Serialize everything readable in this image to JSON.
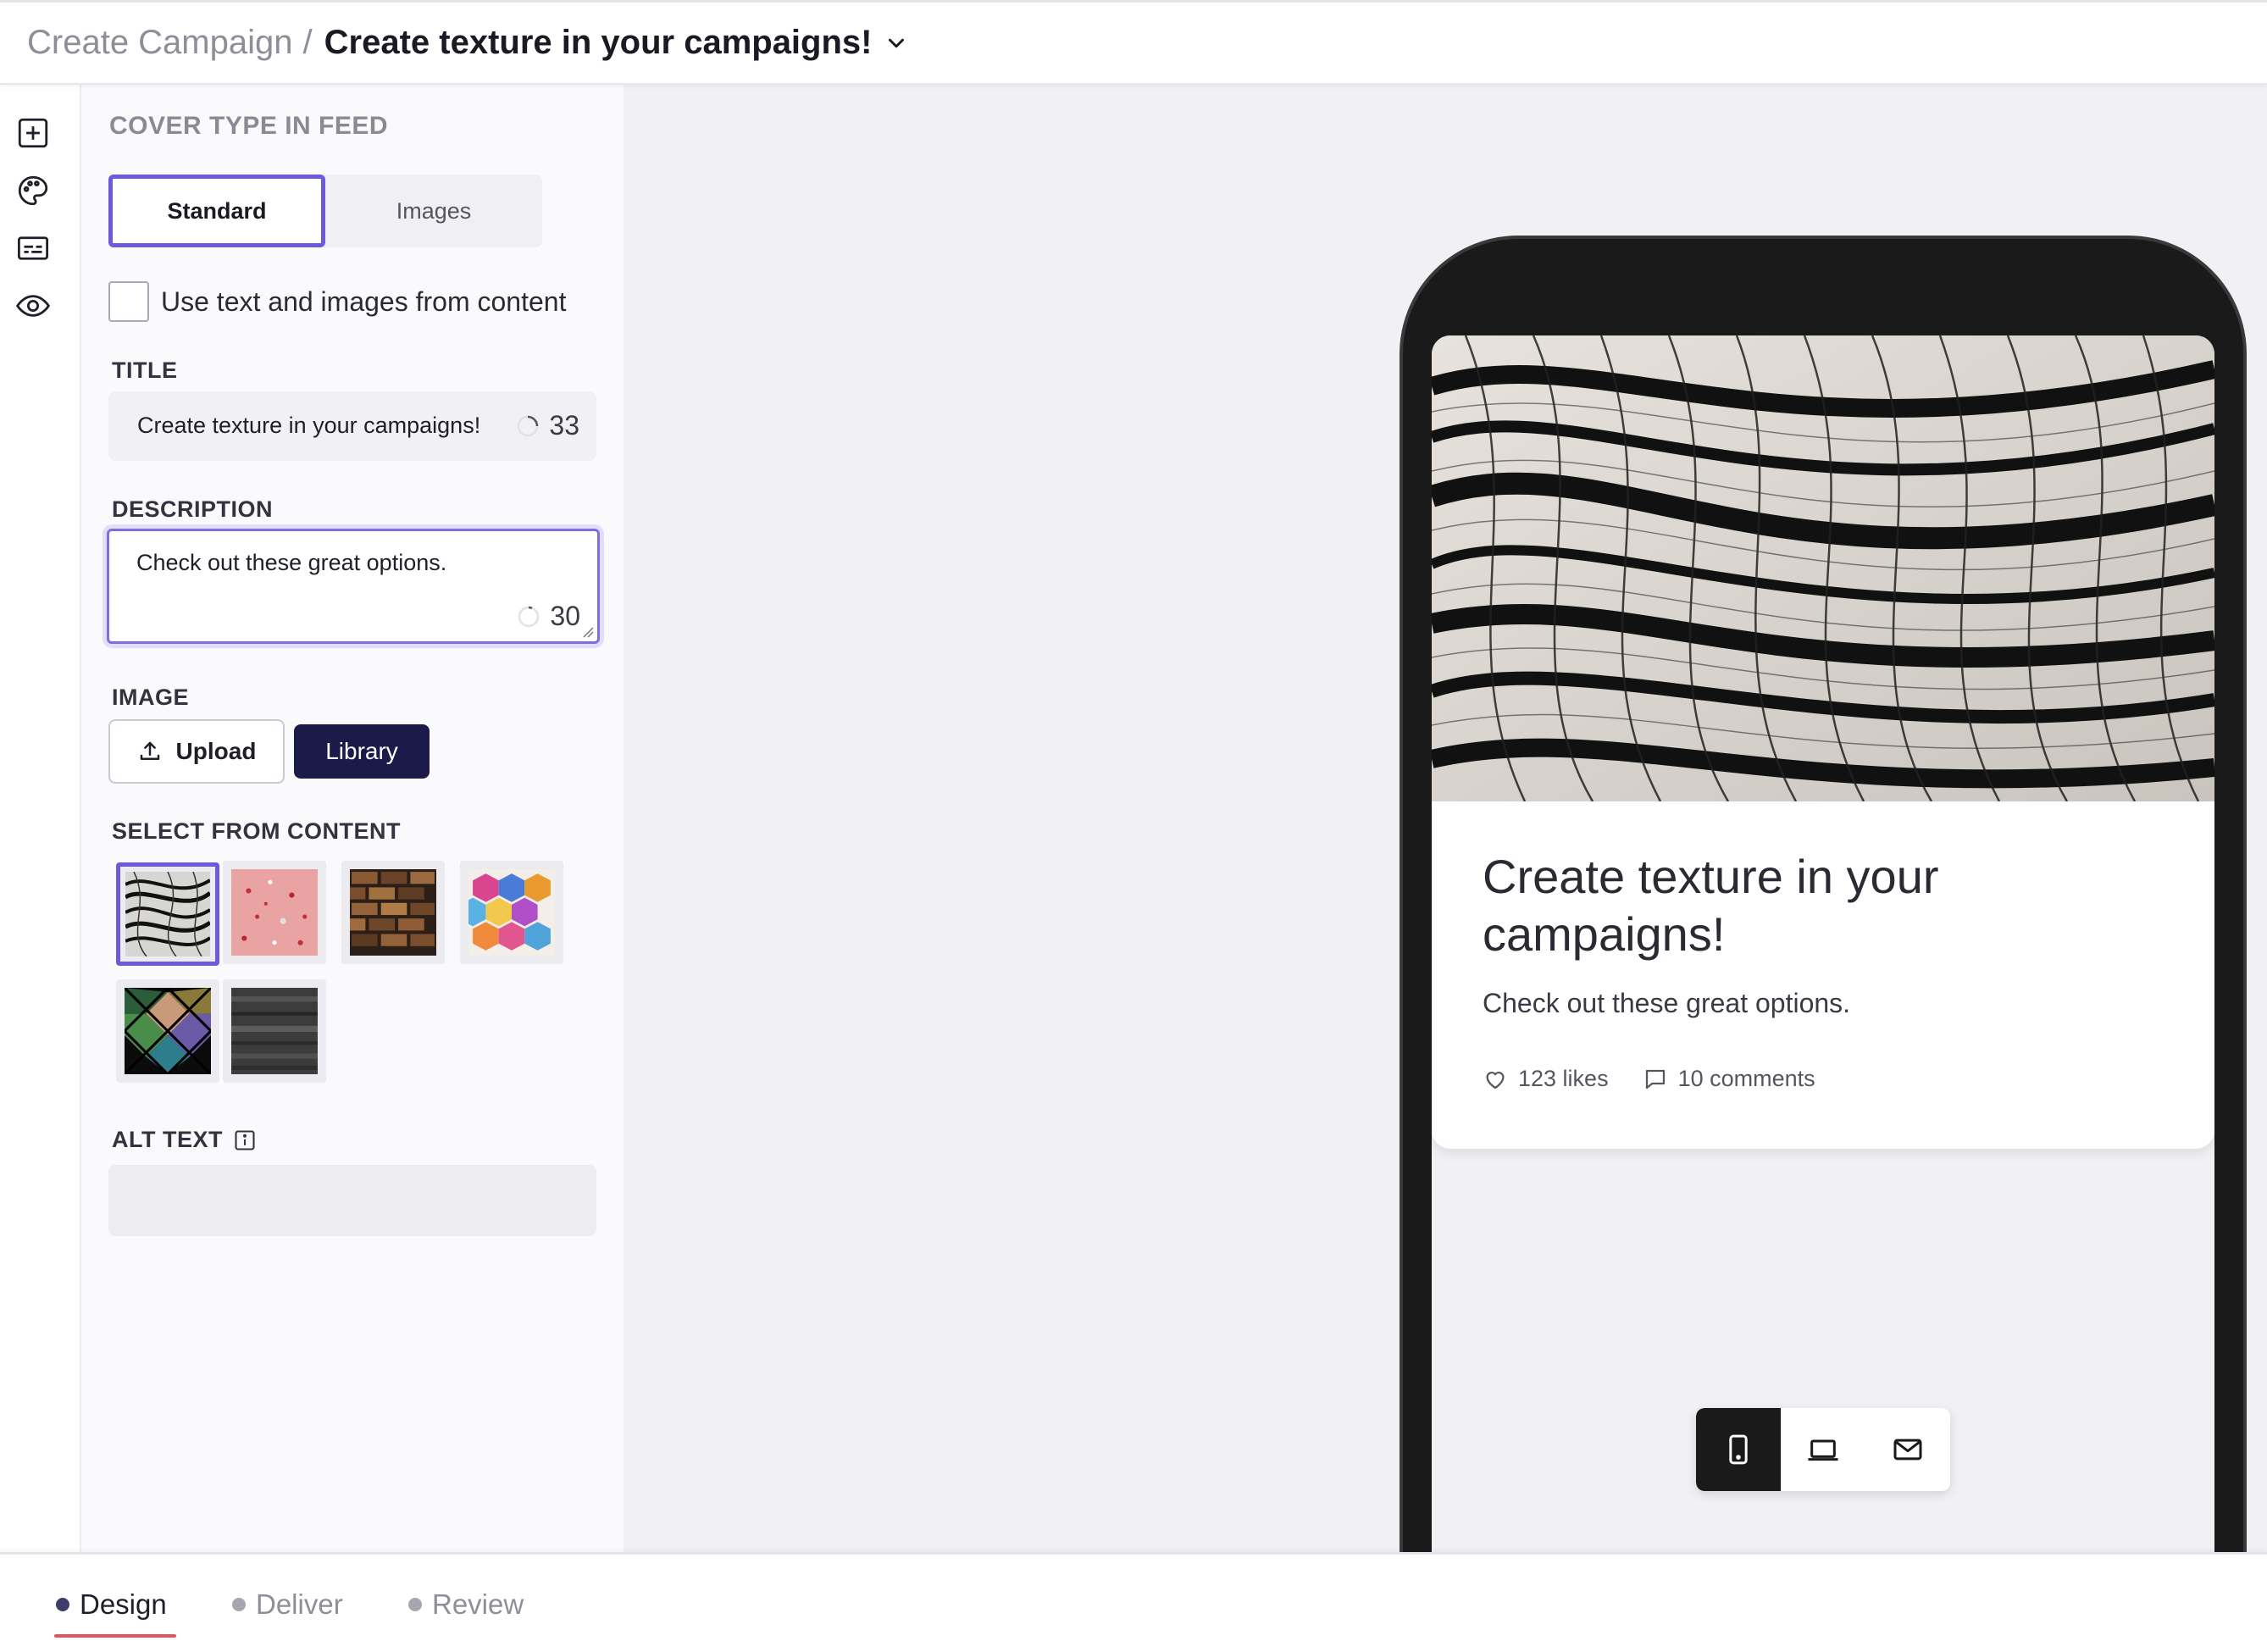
{
  "header": {
    "breadcrumb_root": "Create Campaign",
    "breadcrumb_separator": "/",
    "breadcrumb_current": "Create texture in your campaigns!"
  },
  "rail": {
    "icons": [
      "add-square-icon",
      "palette-icon",
      "captions-icon",
      "eye-icon"
    ]
  },
  "panel": {
    "cover_type_label": "COVER TYPE IN FEED",
    "cover_types": [
      "Standard",
      "Images"
    ],
    "cover_type_selected": "Standard",
    "use_content_label": "Use text and images from content",
    "use_content_checked": false,
    "title_label": "TITLE",
    "title_value": "Create texture in your campaigns!",
    "title_remaining": "33",
    "description_label": "DESCRIPTION",
    "description_value": "Check out these great options.",
    "description_remaining": "30",
    "image_label": "IMAGE",
    "upload_label": "Upload",
    "library_label": "Library",
    "select_from_content_label": "SELECT FROM CONTENT",
    "thumbnails": [
      "wavy-mesh",
      "pink-confetti",
      "brick-wall",
      "hexagon-cubes",
      "stained-glass",
      "dark-noise"
    ],
    "selected_thumbnail": "wavy-mesh",
    "alt_text_label": "ALT TEXT",
    "alt_text_value": ""
  },
  "preview": {
    "card_title": "Create texture in your campaigns!",
    "card_description": "Check out these great options.",
    "likes": "123 likes",
    "comments": "10 comments",
    "devices": [
      "mobile",
      "laptop",
      "email"
    ],
    "active_device": "mobile"
  },
  "steps": {
    "items": [
      "Design",
      "Deliver",
      "Review"
    ],
    "active": "Design"
  },
  "colors": {
    "accent": "#6b5bdc",
    "library_button": "#1b1a48",
    "step_underline": "#e0565b"
  }
}
